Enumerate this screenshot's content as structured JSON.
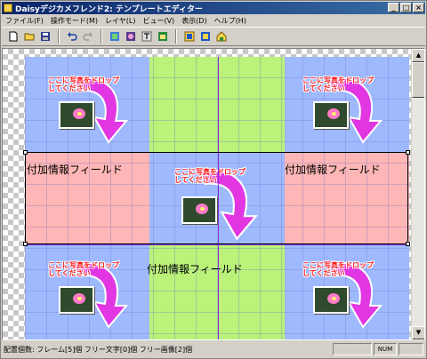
{
  "window": {
    "title": "Daisyデジカメフレンド2: テンプレートエディター"
  },
  "menu": [
    "ファイル(F)",
    "操作モード(M)",
    "レイヤ(L)",
    "ビュー(V)",
    "表示(D)",
    "ヘルプ(H)"
  ],
  "toolbar": [
    {
      "name": "new-icon"
    },
    {
      "name": "open-icon"
    },
    {
      "name": "save-icon"
    },
    {
      "name": "undo-icon"
    },
    {
      "name": "redo-icon"
    },
    {
      "name": "frame-tool-icon"
    },
    {
      "name": "photo-tool-icon"
    },
    {
      "name": "text-tool-icon"
    },
    {
      "name": "image-tool-icon"
    },
    {
      "name": "layer-up-icon"
    },
    {
      "name": "layer-down-icon"
    },
    {
      "name": "properties-icon"
    }
  ],
  "canvas": {
    "drop_label_line1": "ここに写真をドロップ",
    "drop_label_line2": "してください",
    "info_field_label": "付加情報フィールド",
    "colors": {
      "blue": "#9fb9ff",
      "green": "#baf27a",
      "pink": "#ffb6b6",
      "guide": "#8a2be2"
    }
  },
  "status": {
    "text": "配置個数: フレーム[5]個  フリー文字[0]個  フリー画像[2]個",
    "num": "NUM"
  }
}
